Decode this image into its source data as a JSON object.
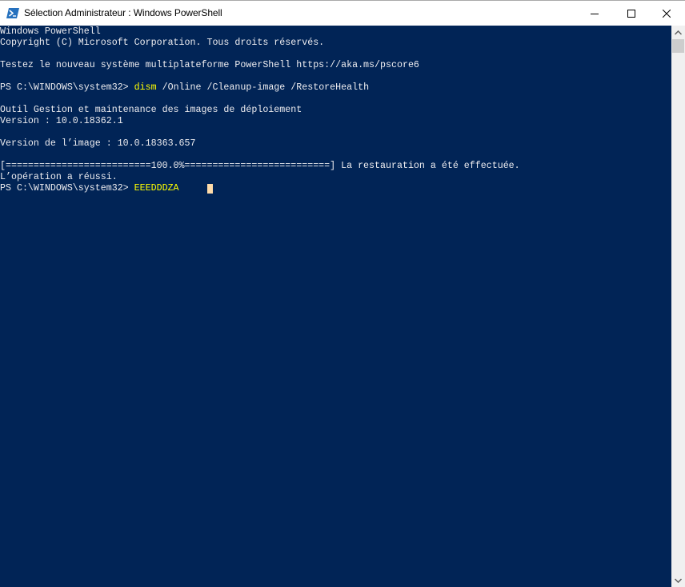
{
  "window": {
    "title": "Sélection Administrateur : Windows PowerShell",
    "icon": "powershell-icon",
    "controls": {
      "minimize": "minimize-icon",
      "maximize": "maximize-icon",
      "close": "close-icon"
    }
  },
  "terminal": {
    "background_color": "#012456",
    "text_color": "#eeedf0",
    "command_color": "#ffff00",
    "lines": [
      {
        "text": "Windows PowerShell"
      },
      {
        "text": "Copyright (C) Microsoft Corporation. Tous droits réservés."
      },
      {
        "text": ""
      },
      {
        "text": "Testez le nouveau système multiplateforme PowerShell https://aka.ms/pscore6"
      },
      {
        "text": ""
      },
      {
        "prompt": "PS C:\\WINDOWS\\system32> ",
        "command": "dism",
        "args": " /Online /Cleanup-image /RestoreHealth"
      },
      {
        "text": ""
      },
      {
        "text": "Outil Gestion et maintenance des images de déploiement"
      },
      {
        "text": "Version : 10.0.18362.1"
      },
      {
        "text": ""
      },
      {
        "text": "Version de l’image : 10.0.18363.657"
      },
      {
        "text": ""
      },
      {
        "text": "[==========================100.0%==========================] La restauration a été effectuée."
      },
      {
        "text": "L’opération a réussi."
      },
      {
        "prompt": "PS C:\\WINDOWS\\system32> ",
        "command": "EEEDDDZA",
        "args": ""
      }
    ],
    "progress_percent": 100.0
  },
  "scrollbar": {
    "up": "chevron-up-icon",
    "down": "chevron-down-icon"
  }
}
